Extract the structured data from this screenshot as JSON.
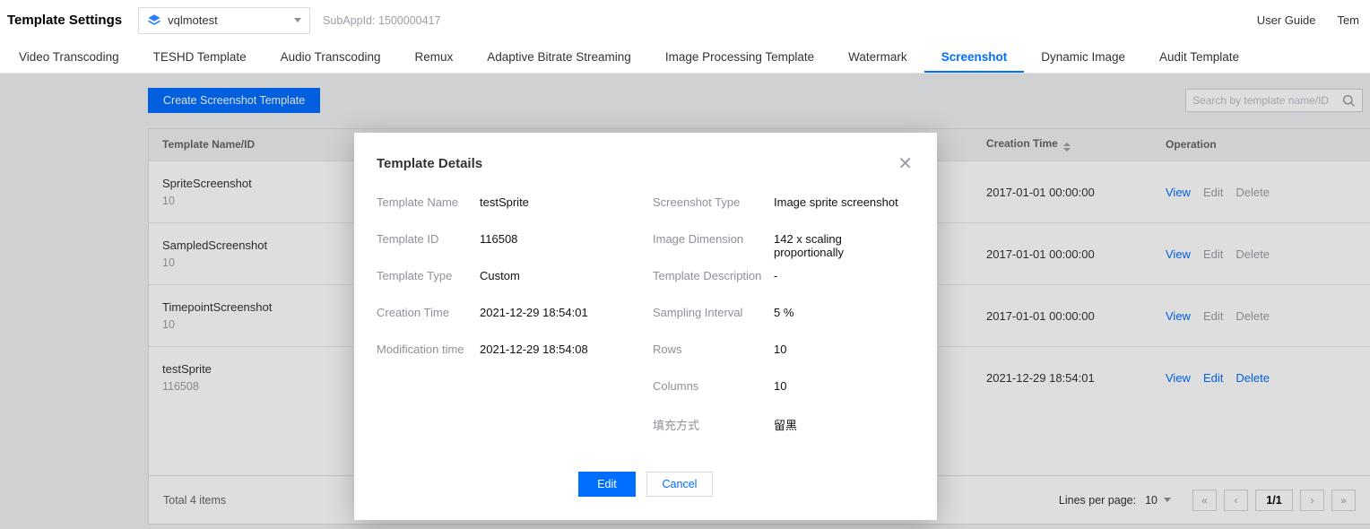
{
  "colors": {
    "accent": "#006eff"
  },
  "header": {
    "title": "Template Settings",
    "app_selector": {
      "value": "vqlmotest"
    },
    "subappid": "SubAppId: 1500000417",
    "links": [
      "User Guide",
      "Tem"
    ]
  },
  "tabs": [
    {
      "label": "Video Transcoding",
      "active": false
    },
    {
      "label": "TESHD Template",
      "active": false
    },
    {
      "label": "Audio Transcoding",
      "active": false
    },
    {
      "label": "Remux",
      "active": false
    },
    {
      "label": "Adaptive Bitrate Streaming",
      "active": false
    },
    {
      "label": "Image Processing Template",
      "active": false
    },
    {
      "label": "Watermark",
      "active": false
    },
    {
      "label": "Screenshot",
      "active": true
    },
    {
      "label": "Dynamic Image",
      "active": false
    },
    {
      "label": "Audit Template",
      "active": false
    }
  ],
  "toolbar": {
    "create_button": "Create Screenshot Template",
    "search_placeholder": "Search by template name/ID"
  },
  "table": {
    "headers": {
      "name": "Template Name/ID",
      "creation": "Creation Time",
      "operation": "Operation"
    },
    "rows": [
      {
        "name": "SpriteScreenshot",
        "id": "10",
        "creation": "2017-01-01 00:00:00",
        "ops": [
          "View",
          "Edit",
          "Delete"
        ]
      },
      {
        "name": "SampledScreenshot",
        "id": "10",
        "creation": "2017-01-01 00:00:00",
        "ops": [
          "View",
          "Edit",
          "Delete"
        ]
      },
      {
        "name": "TimepointScreenshot",
        "id": "10",
        "creation": "2017-01-01 00:00:00",
        "ops": [
          "View",
          "Edit",
          "Delete"
        ]
      },
      {
        "name": "testSprite",
        "id": "116508",
        "creation": "2021-12-29 18:54:01",
        "ops": [
          "View",
          "Edit",
          "Delete"
        ]
      }
    ],
    "footer": {
      "total": "Total 4 items",
      "lines_per_page_label": "Lines per page:",
      "lines_per_page_value": "10",
      "page_indicator": "1/1"
    }
  },
  "modal": {
    "title": "Template Details",
    "left_fields": [
      {
        "label": "Template Name",
        "value": "testSprite"
      },
      {
        "label": "Template ID",
        "value": "116508"
      },
      {
        "label": "Template Type",
        "value": "Custom"
      },
      {
        "label": "Creation Time",
        "value": "2021-12-29 18:54:01"
      },
      {
        "label": "Modification time",
        "value": "2021-12-29 18:54:08"
      }
    ],
    "right_fields": [
      {
        "label": "Screenshot Type",
        "value": "Image sprite screenshot"
      },
      {
        "label": "Image Dimension",
        "value": "142 x scaling proportionally"
      },
      {
        "label": "Template Description",
        "value": "-"
      },
      {
        "label": "Sampling Interval",
        "value": "5 %"
      },
      {
        "label": "Rows",
        "value": "10"
      },
      {
        "label": "Columns",
        "value": "10"
      },
      {
        "label": "填充方式",
        "value": "留黑"
      }
    ],
    "edit_button": "Edit",
    "cancel_button": "Cancel"
  }
}
